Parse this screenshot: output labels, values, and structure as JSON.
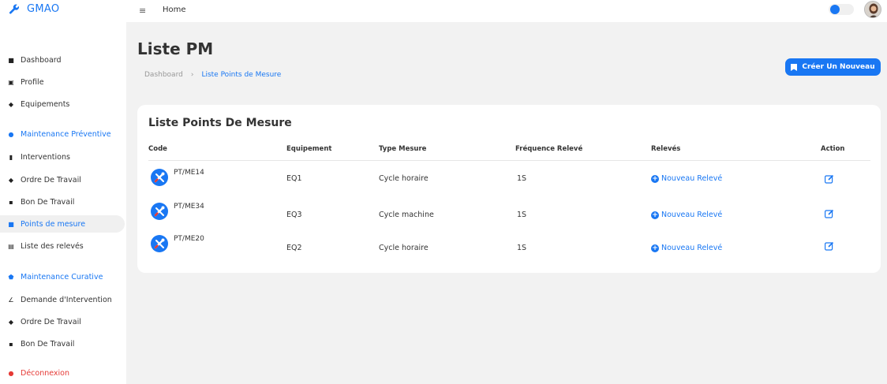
{
  "app": {
    "title": "GMAO",
    "menu_icon": "hamburger-icon",
    "breadcrumb_home": "Home",
    "accent_color": "#1977f3"
  },
  "sidebar": {
    "items": [
      {
        "label": "Dashboard",
        "icon": "dashboard-icon",
        "type": "item"
      },
      {
        "label": "Profile",
        "icon": "profile-icon",
        "type": "item"
      },
      {
        "label": "Equipements",
        "icon": "equipment-icon",
        "type": "item"
      },
      {
        "label": "Maintenance Préventive",
        "icon": "circle-icon",
        "type": "section"
      },
      {
        "label": "Interventions",
        "icon": "clipboard-icon",
        "type": "item"
      },
      {
        "label": "Ordre De Travail",
        "icon": "diamond-icon",
        "type": "item"
      },
      {
        "label": "Bon De Travail",
        "icon": "document-icon",
        "type": "item"
      },
      {
        "label": "Points de mesure",
        "icon": "doc-icon",
        "type": "active"
      },
      {
        "label": "Liste des relevés",
        "icon": "list-icon",
        "type": "item"
      },
      {
        "label": "Maintenance Curative",
        "icon": "shield-icon",
        "type": "section"
      },
      {
        "label": "Demande d'Intervention",
        "icon": "pen-icon",
        "type": "item"
      },
      {
        "label": "Ordre De Travail",
        "icon": "diamond-icon",
        "type": "item"
      },
      {
        "label": "Bon De Travail",
        "icon": "document-icon",
        "type": "item"
      },
      {
        "label": "Déconnexion",
        "icon": "logout-icon",
        "type": "logout"
      }
    ]
  },
  "page": {
    "title": "Liste PM",
    "breadcrumb_root": "Dashboard",
    "breadcrumb_sep": "›",
    "breadcrumb_current": "Liste Points de Mesure",
    "create_button": "Créer Un Nouveau"
  },
  "table": {
    "title": "Liste Points De Mesure",
    "columns": [
      "Code",
      "Equipement",
      "Type Mesure",
      "Fréquence Relevé",
      "Relevés",
      "Action"
    ],
    "rows": [
      {
        "code": "PT/ME14",
        "equipement": "EQ1",
        "type": "Cycle horaire",
        "frequence": "1S",
        "releve": "Nouveau Relevé"
      },
      {
        "code": "PT/ME34",
        "equipement": "EQ3",
        "type": "Cycle machine",
        "frequence": "1S",
        "releve": "Nouveau Relevé"
      },
      {
        "code": "PT/ME20",
        "equipement": "EQ2",
        "type": "Cycle horaire",
        "frequence": "1S",
        "releve": "Nouveau Relevé"
      }
    ]
  }
}
